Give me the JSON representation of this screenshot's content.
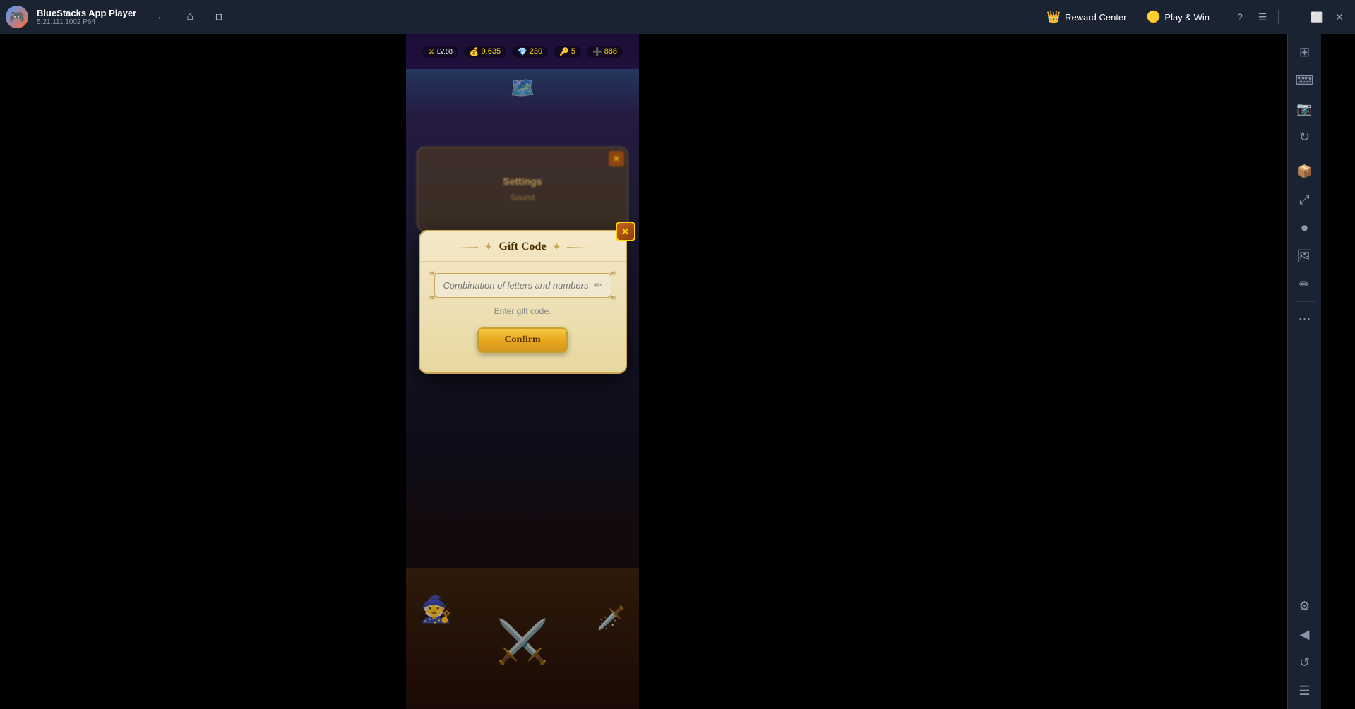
{
  "titleBar": {
    "appName": "BlueStacks App Player",
    "version": "5.21.111.1002  P64",
    "logoEmoji": "🎮",
    "nav": {
      "back": "←",
      "home": "⌂",
      "tabs": "⧉"
    },
    "rewardCenter": {
      "icon": "👑",
      "label": "Reward Center"
    },
    "playAndWin": {
      "icon": "🟡",
      "label": "Play & Win"
    },
    "helpBtn": "?",
    "menuBtn": "☰",
    "minimizeBtn": "—",
    "maximizeBtn": "⬜",
    "closeBtn": "✕"
  },
  "giftDialog": {
    "title": "Gift Code",
    "closeBtn": "✕",
    "inputPlaceholder": "Combination of letters and numbers",
    "editIcon": "✏",
    "hintText": "Enter gift code.",
    "confirmBtn": "Confirm"
  },
  "settingsDialog": {
    "title": "Settings",
    "subTitle": "Sound",
    "closeBtn": "✕"
  },
  "rightSidebar": {
    "icons": [
      {
        "name": "sidebar-top-icon",
        "glyph": "⊞"
      },
      {
        "name": "sidebar-keyboard-icon",
        "glyph": "⌨"
      },
      {
        "name": "sidebar-camera-icon",
        "glyph": "📷"
      },
      {
        "name": "sidebar-rotate-icon",
        "glyph": "↻"
      },
      {
        "name": "sidebar-apk-icon",
        "glyph": "📦"
      },
      {
        "name": "sidebar-resize-icon",
        "glyph": "⤢"
      },
      {
        "name": "sidebar-macro-icon",
        "glyph": "⏺"
      },
      {
        "name": "sidebar-screenshot-icon",
        "glyph": "🖼"
      },
      {
        "name": "sidebar-edit-icon",
        "glyph": "✏"
      },
      {
        "name": "sidebar-more-icon",
        "glyph": "⋯"
      },
      {
        "name": "sidebar-settings-icon",
        "glyph": "⚙"
      },
      {
        "name": "sidebar-arrow-icon",
        "glyph": "◀"
      },
      {
        "name": "sidebar-refresh-icon",
        "glyph": "↺"
      },
      {
        "name": "sidebar-bottom-icon",
        "glyph": "☰"
      }
    ]
  }
}
